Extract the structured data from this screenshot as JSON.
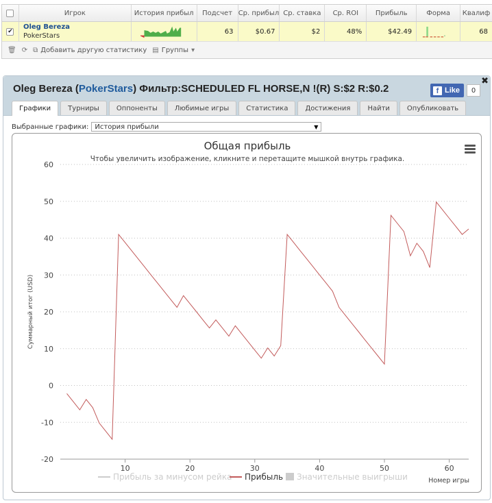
{
  "table": {
    "headers": [
      "Игрок",
      "История прибыл",
      "Подсчет",
      "Ср. прибыл",
      "Ср. ставка",
      "Ср. ROI",
      "Прибыль",
      "Форма",
      "Квалиф"
    ],
    "row": {
      "player_name": "Oleg Bereza",
      "room": "PokerStars",
      "count": "63",
      "avg_profit": "$0.67",
      "avg_stake": "$2",
      "avg_roi": "48%",
      "profit": "$42.49",
      "qual": "68"
    },
    "tools": {
      "add_stat": "Добавить другую статистику",
      "groups": "Группы"
    }
  },
  "panel": {
    "title_player": "Oleg Bereza",
    "title_open": " (",
    "title_room": "PokerStars",
    "title_filter": ") Фильтр:SCHEDULED FL HORSE,N !(R) S:$2 R:$0.2",
    "like_label": "Like",
    "like_count": "0",
    "tabs": [
      "Графики",
      "Турниры",
      "Оппоненты",
      "Любимые игры",
      "Статистика",
      "Достижения",
      "Найти",
      "Опубликовать"
    ],
    "active_tab": 0,
    "select_label": "Выбранные графики:",
    "select_value": "История прибыли"
  },
  "colors": {
    "series_profit": "#c25a5a",
    "legend_inactive": "#cccccc",
    "title": "#333333",
    "gridline": "#c0c0c0"
  },
  "chart_data": {
    "type": "line",
    "title": "Общая прибыль",
    "subtitle": "Чтобы увеличить изображение, кликните и перетащите мышкой внутрь графика.",
    "ylabel": "Суммарный итог (USD)",
    "xlabel": "Номер игры",
    "xlim": [
      0,
      63
    ],
    "ylim": [
      -20,
      60
    ],
    "xticks": [
      10,
      20,
      30,
      40,
      50,
      60
    ],
    "yticks": [
      -20,
      -10,
      0,
      10,
      20,
      30,
      40,
      50,
      60
    ],
    "grid": true,
    "legend_position": "bottom",
    "legend": [
      {
        "name": "Прибыль за минусом рейка",
        "active": false,
        "symbol": "line"
      },
      {
        "name": "Прибыль",
        "active": true,
        "symbol": "line"
      },
      {
        "name": "Значительные выигрыши",
        "active": false,
        "symbol": "box"
      }
    ],
    "series": [
      {
        "name": "Прибыль",
        "x": [
          1,
          2,
          3,
          4,
          5,
          6,
          7,
          8,
          9,
          10,
          11,
          12,
          13,
          14,
          15,
          16,
          17,
          18,
          19,
          20,
          21,
          22,
          23,
          24,
          25,
          26,
          27,
          28,
          29,
          30,
          31,
          32,
          33,
          34,
          35,
          36,
          37,
          38,
          39,
          40,
          41,
          42,
          43,
          44,
          45,
          46,
          47,
          48,
          49,
          50,
          51,
          52,
          53,
          54,
          55,
          56,
          57,
          58,
          59,
          60,
          61,
          62,
          63
        ],
        "values": [
          -2.2,
          -4.4,
          -6.6,
          -3.8,
          -6.0,
          -10.2,
          -12.4,
          -14.6,
          41.0,
          38.8,
          36.6,
          34.4,
          32.2,
          30.0,
          27.8,
          25.6,
          23.4,
          21.2,
          24.4,
          22.2,
          20.0,
          17.8,
          15.6,
          17.8,
          15.6,
          13.4,
          16.2,
          14.0,
          11.8,
          9.6,
          7.4,
          10.2,
          8.0,
          10.8,
          41.0,
          38.8,
          36.6,
          34.4,
          32.2,
          30.0,
          27.8,
          25.6,
          21.2,
          19.0,
          16.8,
          14.6,
          12.4,
          10.2,
          8.0,
          5.8,
          46.2,
          44.0,
          41.8,
          35.2,
          38.6,
          36.4,
          32.0,
          49.8,
          47.6,
          45.4,
          43.2,
          41.0,
          42.5
        ]
      }
    ]
  }
}
